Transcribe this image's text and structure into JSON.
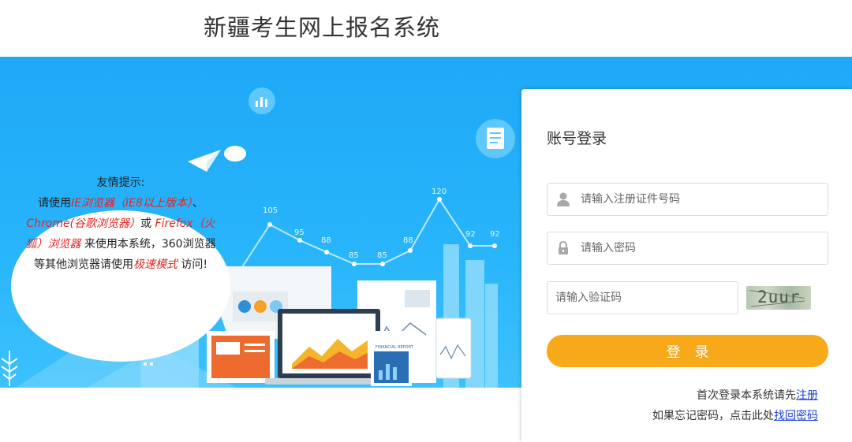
{
  "header": {
    "title": "新疆考生网上报名系统"
  },
  "banner": {
    "chart_values": [
      "80",
      "105",
      "95",
      "88",
      "85",
      "85",
      "88",
      "120",
      "92",
      "92"
    ],
    "report_label": "FINANCIAL REPORT"
  },
  "tip": {
    "title": "友情提示:",
    "line2_pre": "请使用",
    "line2_hl": "IE浏览器（IE8以上版本）",
    "line2_post": "、",
    "line3_hl1": "Chrome(谷歌浏览器）",
    "line3_mid": "或 ",
    "line3_hl2": "Firefox（火",
    "line4_hl": "狐）浏览器",
    "line4_post": " 来使用本系统，360浏览器",
    "line5_pre": "等其他浏览器请使用",
    "line5_hl": "极速模式",
    "line5_post": " 访问!"
  },
  "login": {
    "title": "账号登录",
    "username_placeholder": "请输入注册证件号码",
    "password_placeholder": "请输入密码",
    "captcha_placeholder": "请输入验证码",
    "captcha_text": "2uur",
    "submit_label": "登录",
    "note1_text": "首次登录本系统请先",
    "note1_link": "注册",
    "note2_text": "如果忘记密码，点击此处",
    "note2_link": "找回密码"
  },
  "colors": {
    "banner": "#27b4fb",
    "button": "#f8a91a",
    "highlight": "#e8231f",
    "link": "#1a3fd6"
  },
  "icons": [
    "user-icon",
    "lock-icon",
    "document-icon",
    "bar-chart-icon",
    "paper-plane-icon"
  ]
}
